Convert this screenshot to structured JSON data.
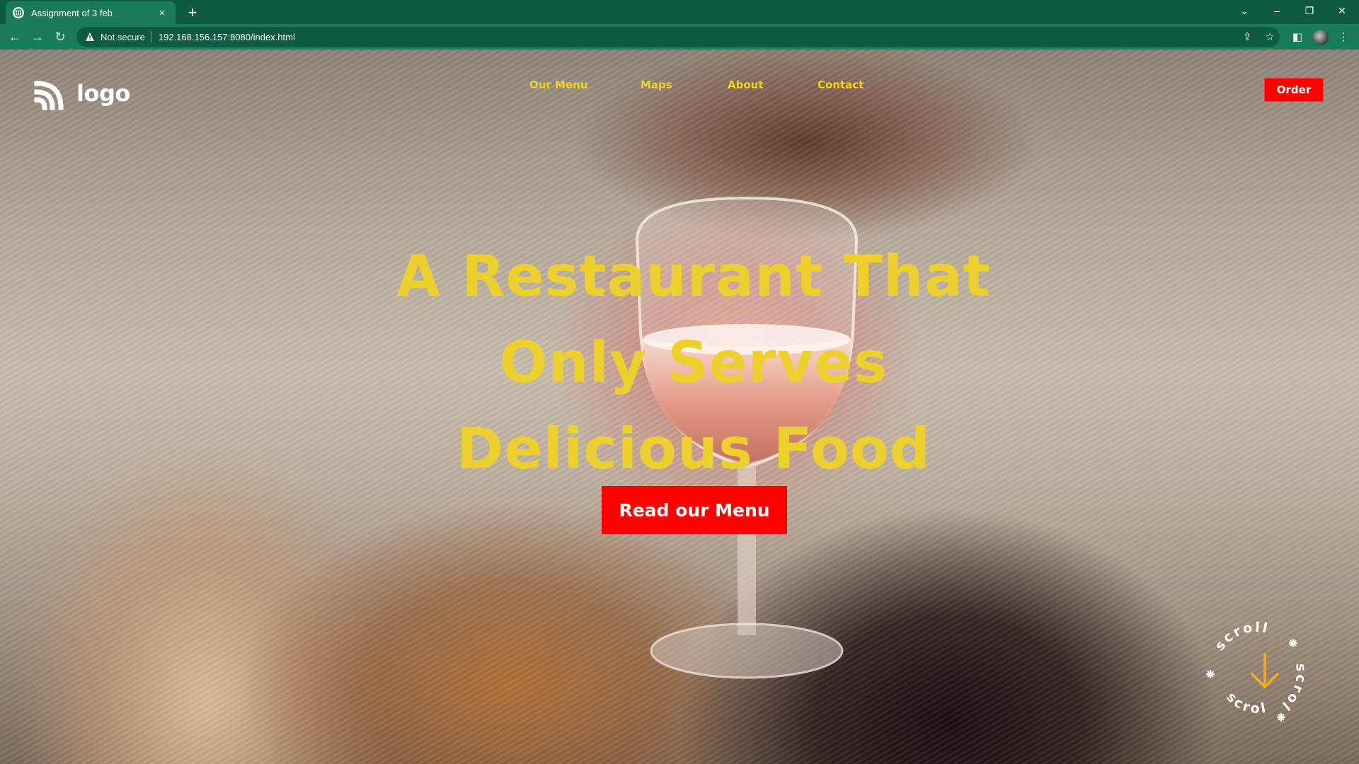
{
  "browser": {
    "tab_title": "Assignment of 3 feb",
    "tab_close": "×",
    "new_tab": "+",
    "security_label": "Not secure",
    "url": "192.168.156.157:8080/index.html",
    "controls": {
      "list": "⌄",
      "minimize": "–",
      "restore": "❐",
      "close": "✕"
    },
    "nav": {
      "back": "←",
      "forward": "→",
      "reload": "↻"
    },
    "toolbar_icons": {
      "share": "⇪",
      "star": "☆",
      "sidepanel": "◧",
      "menu": "⋮"
    }
  },
  "site": {
    "logo_text": "logo",
    "nav": [
      "Our Menu",
      "Maps",
      "About",
      "Contact"
    ],
    "order_label": "Order",
    "hero_lines": [
      "A Restaurant That",
      "Only Serves",
      "Delicious Food"
    ],
    "cta_label": "Read our Menu",
    "scroll_text": "scroll"
  },
  "colors": {
    "browser_frame": "#0f5a44",
    "browser_toolbar": "#1a7a5c",
    "accent_yellow": "#ecd02f",
    "nav_yellow": "#f2d12c",
    "button_red": "#ff0000",
    "scroll_arrow": "#f2b01e"
  },
  "icons": {
    "favicon": "globe-icon",
    "warning": "warning-triangle-icon",
    "logo": "rss-feed-icon",
    "scroll_arrow": "arrow-down-icon",
    "scroll_star": "asterisk-icon"
  }
}
